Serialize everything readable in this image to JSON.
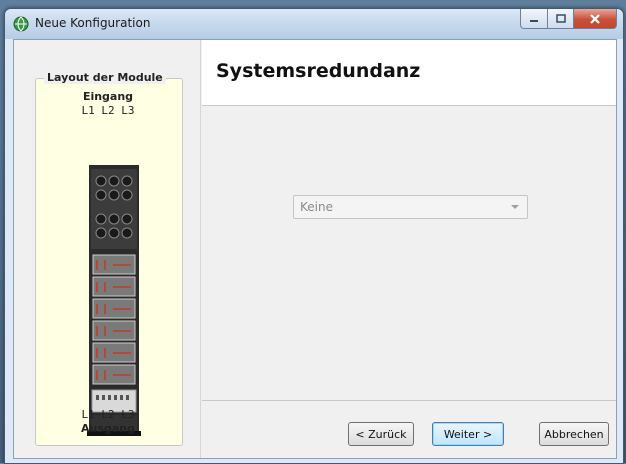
{
  "window": {
    "title": "Neue Konfiguration",
    "icon": "globe-app-icon"
  },
  "left_panel": {
    "group_title": "Layout der Module",
    "input_label": "Eingang",
    "input_phases": "L1  L2  L3",
    "output_phases": "L1  L2  L3",
    "output_label": "Ausgang",
    "image": "ups-rack-module-layout"
  },
  "main": {
    "heading": "Systemsredundanz",
    "redundancy_select": {
      "value": "Keine",
      "enabled": false
    }
  },
  "buttons": {
    "back": "< Zurück",
    "next": "Weiter >",
    "cancel": "Abbrechen"
  },
  "colors": {
    "group_background": "#ffffe4",
    "default_button_border": "#3c7fb1",
    "close_button": "#c9513a"
  }
}
